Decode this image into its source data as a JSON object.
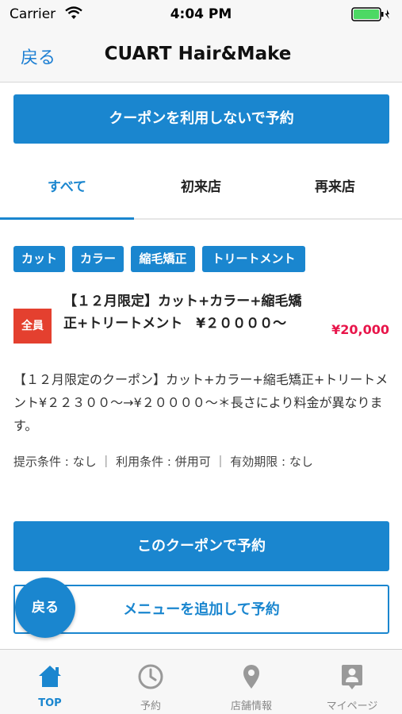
{
  "status_bar": {
    "carrier": "Carrier",
    "time": "4:04 PM"
  },
  "nav": {
    "back_label": "戻る",
    "title": "CUART Hair&Make"
  },
  "reserve_without_coupon_label": "クーポンを利用しないで予約",
  "tabs": [
    {
      "label": "すべて",
      "active": true
    },
    {
      "label": "初来店",
      "active": false
    },
    {
      "label": "再来店",
      "active": false
    }
  ],
  "coupon": {
    "tags": [
      "カット",
      "カラー",
      "縮毛矯正",
      "トリートメント"
    ],
    "badge": "全員",
    "title": "【１２月限定】カット+カラー+縮毛矯正+トリートメント　¥２００００～",
    "price": "¥20,000",
    "description": "【１２月限定のクーポン】カット+カラー+縮毛矯正+トリートメント¥２２３００～→¥２００００～＊長さにより料金が異なります。",
    "conditions": "提示条件 : なし ｜ 利用条件 : 併用可 ｜ 有効期限 : なし",
    "use_button_label": "このクーポンで予約",
    "add_menu_button_label": "メニューを追加して予約"
  },
  "floating_back_label": "戻る",
  "tabbar": [
    {
      "label": "TOP",
      "icon": "home-icon",
      "active": true
    },
    {
      "label": "予約",
      "icon": "clock-icon",
      "active": false
    },
    {
      "label": "店舗情報",
      "icon": "map-pin-icon",
      "active": false
    },
    {
      "label": "マイページ",
      "icon": "user-card-icon",
      "active": false
    }
  ],
  "colors": {
    "accent": "#1a86cf",
    "badge": "#e4402f",
    "price": "#e8154a",
    "battery": "#4cd964"
  }
}
